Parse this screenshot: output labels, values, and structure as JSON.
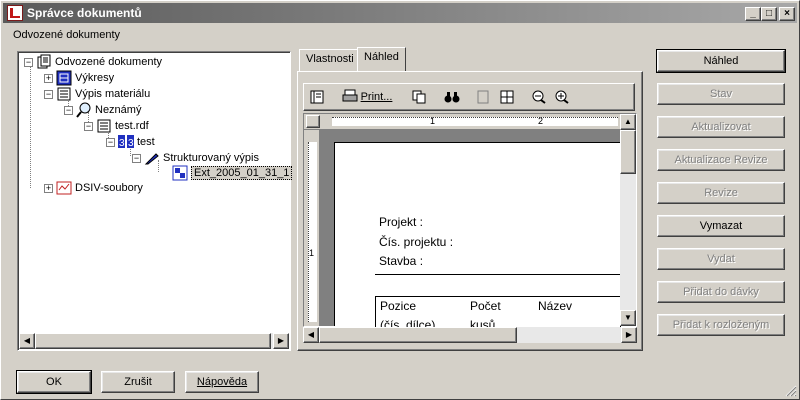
{
  "window": {
    "title": "Správce dokumentů",
    "controls": [
      "_",
      "□",
      "×"
    ]
  },
  "tree_label": "Odvozené dokumenty",
  "tree": {
    "root": "Odvozené dokumenty",
    "vykresy": "Výkresy",
    "vypis": "Výpis materiálu",
    "neznamy": "Neznámý",
    "testrdf": "test.rdf",
    "test": "test",
    "struktur": "Strukturovaný výpis",
    "ext": "Ext_2005_01_31_1",
    "dsiv": "DSIV-soubory"
  },
  "tabs": [
    "Vlastnosti",
    "Náhled"
  ],
  "toolbar": {
    "print_label": "Print..."
  },
  "ruler": {
    "marks": [
      "1",
      "2"
    ]
  },
  "preview": {
    "projekt": "Projekt :",
    "cis_projektu": "Čís. projektu :",
    "stavba": "Stavba :",
    "col_pozice": "Pozice",
    "col_pocet": "Počet",
    "col_nazev": "Název",
    "sub_pozice": "(čís. dílce)",
    "sub_pocet": "kusů"
  },
  "right_buttons": [
    {
      "label": "Náhled",
      "enabled": true
    },
    {
      "label": "Stav",
      "enabled": false
    },
    {
      "label": "Aktualizovat",
      "enabled": false
    },
    {
      "label": "Aktualizace Revize",
      "enabled": false
    },
    {
      "label": "Revize",
      "enabled": false
    },
    {
      "label": "Vymazat",
      "enabled": true
    },
    {
      "label": "Vydat",
      "enabled": false
    },
    {
      "label": "Přidat do dávky",
      "enabled": false
    },
    {
      "label": "Přidat k rozloženým",
      "enabled": false
    }
  ],
  "bottom_buttons": {
    "ok": "OK",
    "cancel": "Zrušit",
    "help": "Nápověda"
  },
  "colors": {
    "face": "#d4d0c8",
    "title_gradient_start": "#5a5a5a",
    "selection": "#d4d0c8"
  }
}
